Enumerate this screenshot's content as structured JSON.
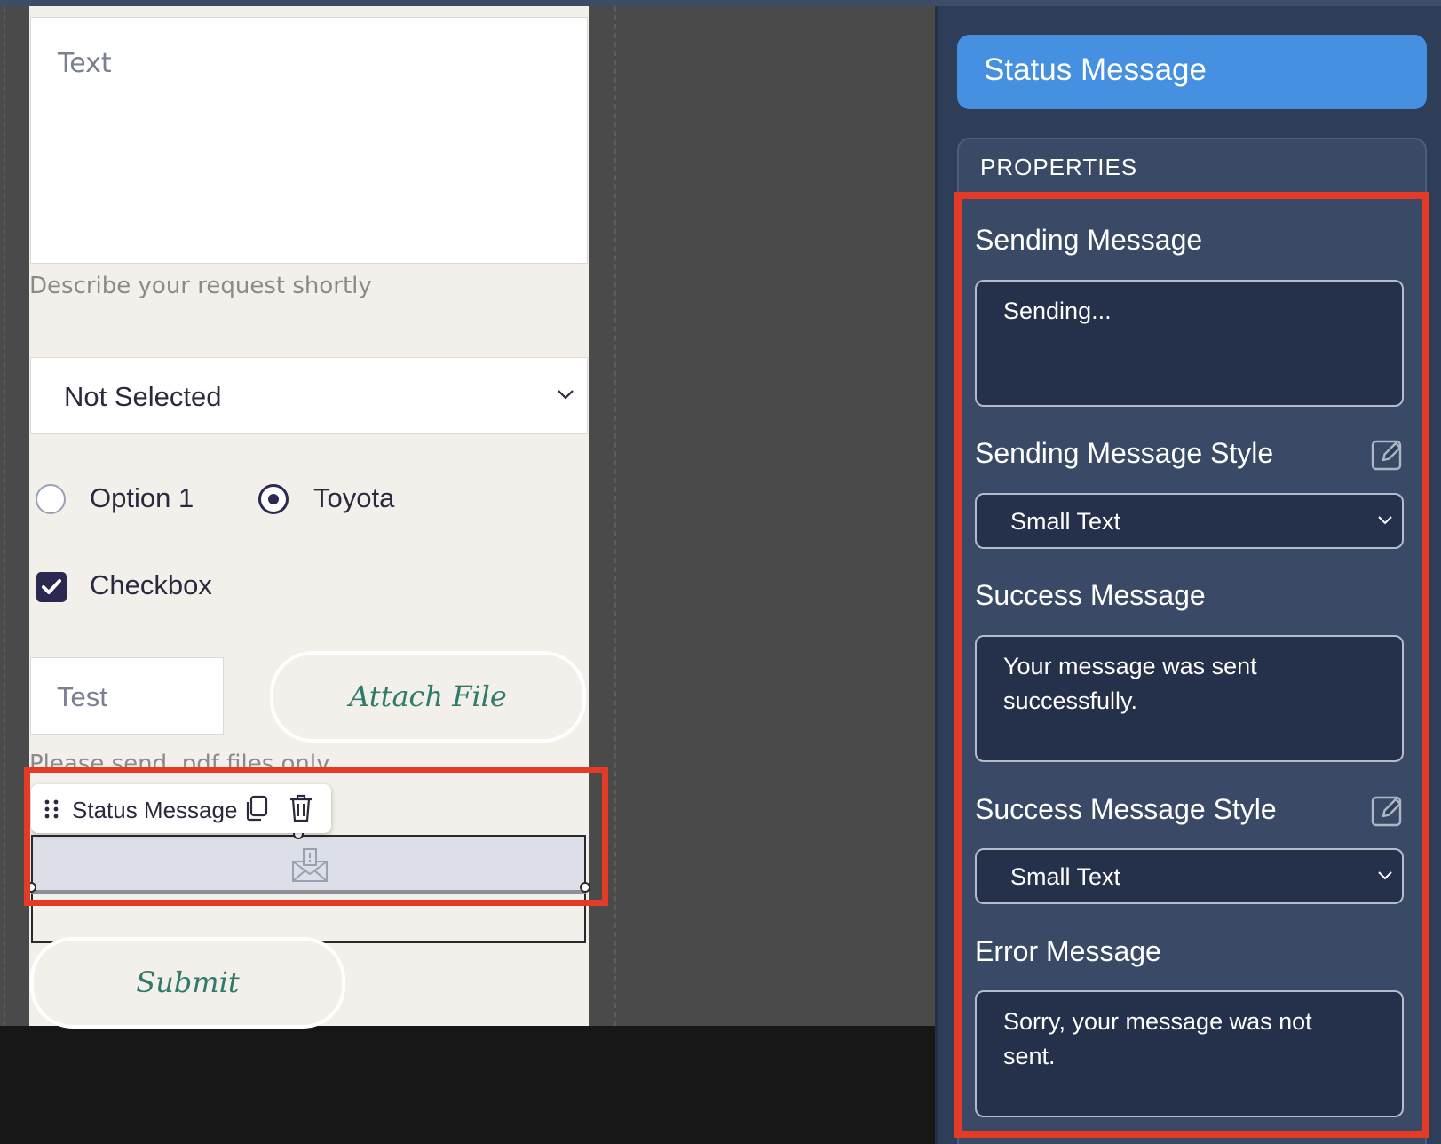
{
  "form_preview": {
    "textarea_placeholder": "Text",
    "textarea_helper": "Describe your request shortly",
    "select_value": "Not Selected",
    "radio_options": [
      {
        "label": "Option 1",
        "selected": false
      },
      {
        "label": "Toyota",
        "selected": true
      }
    ],
    "checkbox": {
      "label": "Checkbox",
      "checked": true
    },
    "input_placeholder": "Test",
    "attach_button": "Attach File",
    "attach_helper": "Please send .pdf files only",
    "submit_button": "Submit",
    "selected_element": {
      "toolbar_label": "Status Message",
      "icon": "envelope-icon"
    }
  },
  "properties_panel": {
    "title": "Status Message",
    "section_header": "PROPERTIES",
    "fields": {
      "sending_message": {
        "label": "Sending Message",
        "value": "Sending..."
      },
      "sending_message_style": {
        "label": "Sending Message Style",
        "value": "Small Text"
      },
      "success_message": {
        "label": "Success Message",
        "value": "Your message was sent successfully."
      },
      "success_message_style": {
        "label": "Success Message Style",
        "value": "Small Text"
      },
      "error_message": {
        "label": "Error Message",
        "value": "Sorry, your message was not sent."
      }
    }
  },
  "colors": {
    "panel_bg": "#2f3e58",
    "title_bar": "#4590e0",
    "highlight": "#e43b26",
    "form_bg": "#f3f0eb",
    "button_text": "#2e7b6a"
  }
}
